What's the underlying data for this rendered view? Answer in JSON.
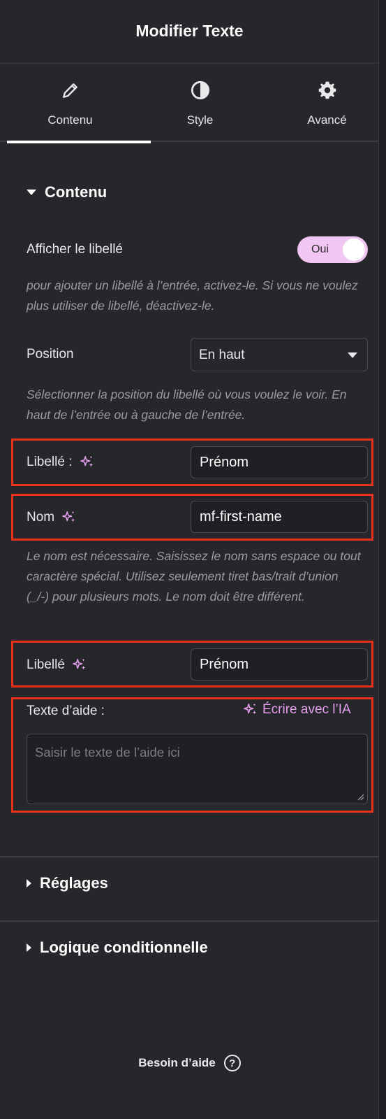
{
  "header": {
    "title": "Modifier Texte"
  },
  "tabs": [
    {
      "label": "Contenu",
      "icon": "pencil-icon",
      "active": true
    },
    {
      "label": "Style",
      "icon": "contrast-icon",
      "active": false
    },
    {
      "label": "Avancé",
      "icon": "gear-icon",
      "active": false
    }
  ],
  "content_section": {
    "title": "Contenu",
    "show_label": {
      "label": "Afficher le libellé",
      "toggle_value": "Oui",
      "help": "pour ajouter un libellé à l’entrée, activez-le. Si vous ne voulez plus utiliser de libellé, déactivez-le."
    },
    "position": {
      "label": "Position",
      "value": "En haut",
      "help": "Sélectionner la position du libellé où vous voulez le voir. En haut de l’entrée ou à gauche de l’entrée."
    },
    "label_field": {
      "label": "Libellé :",
      "value": "Prénom"
    },
    "name_field": {
      "label": "Nom",
      "value": "mf-first-name",
      "help": "Le nom est nécessaire. Saisissez le nom sans espace ou tout caractère spécial. Utilisez seulement tiret bas/trait d’union (_/-) pour plusieurs mots. Le nom doit être différent."
    },
    "label_field_2": {
      "label": "Libellé",
      "value": "Prénom"
    },
    "help_text": {
      "label": "Texte d’aide :",
      "ai_link": "Écrire avec l’IA",
      "placeholder": "Saisir le texte de l’aide ici"
    }
  },
  "settings_section": {
    "title": "Réglages"
  },
  "conditional_section": {
    "title": "Logique conditionnelle"
  },
  "footer": {
    "label": "Besoin d’aide"
  },
  "colors": {
    "accent": "#e49ded",
    "toggle_bg": "#f1c6f3",
    "highlight": "#e8321e"
  }
}
